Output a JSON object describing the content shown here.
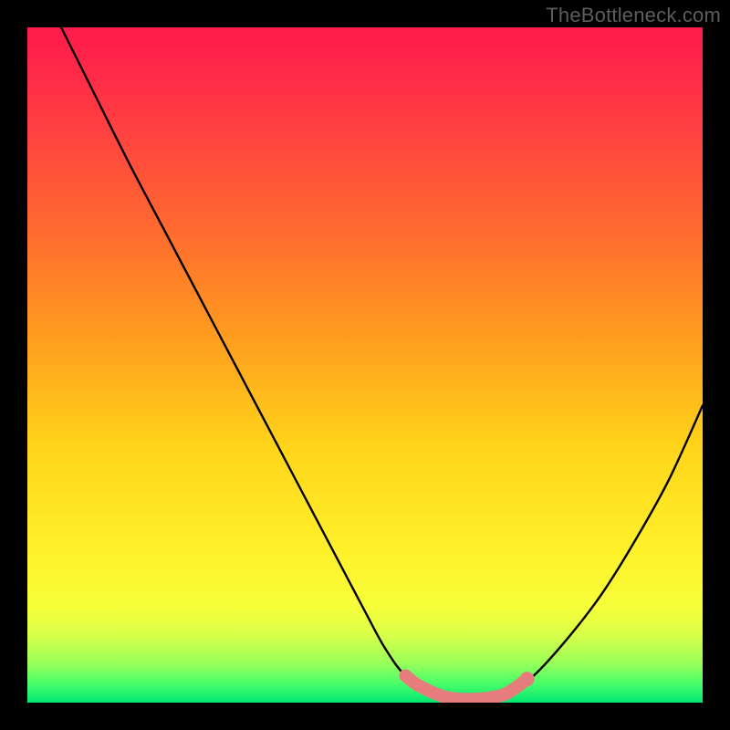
{
  "watermark": "TheBottleneck.com",
  "chart_data": {
    "type": "line",
    "title": "",
    "xlabel": "",
    "ylabel": "",
    "xlim": [
      0,
      100
    ],
    "ylim": [
      0,
      100
    ],
    "series": [
      {
        "name": "bottleneck-curve",
        "x": [
          5,
          10,
          15,
          20,
          25,
          30,
          35,
          40,
          45,
          50,
          53,
          56,
          60,
          64,
          68,
          70,
          72,
          75,
          80,
          85,
          90,
          95,
          100
        ],
        "y": [
          100,
          90,
          80,
          70.5,
          61,
          51.5,
          42,
          32.5,
          23,
          13.5,
          8,
          4,
          1.5,
          0.5,
          0.5,
          1,
          2,
          4,
          9.5,
          16,
          24,
          33,
          44
        ]
      }
    ],
    "highlight_region": {
      "name": "optimal-zone",
      "points": [
        {
          "x": 56,
          "y": 4
        },
        {
          "x": 58,
          "y": 2.5
        },
        {
          "x": 62,
          "y": 0.8
        },
        {
          "x": 66,
          "y": 0.5
        },
        {
          "x": 70,
          "y": 1
        },
        {
          "x": 72,
          "y": 2
        },
        {
          "x": 74,
          "y": 3.5
        }
      ]
    },
    "gradient_colors": {
      "top": "#ff1a4a",
      "mid_upper": "#ff9a1f",
      "mid_lower": "#fff22a",
      "bottom": "#00e874"
    }
  }
}
